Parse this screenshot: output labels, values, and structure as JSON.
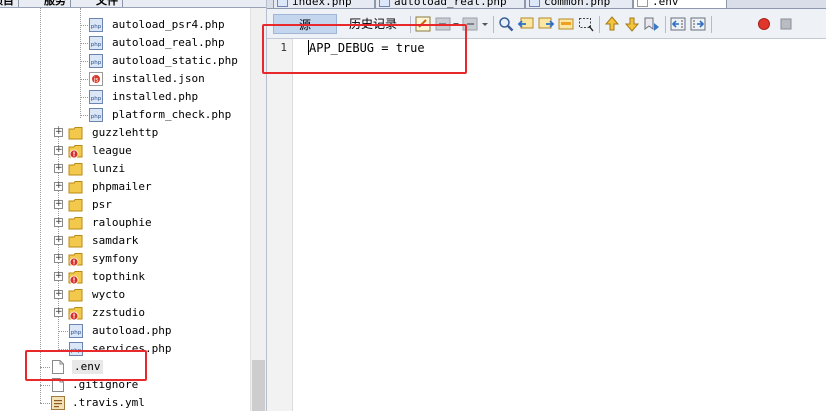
{
  "project_panel": {
    "tabs": [
      "项目",
      "服务",
      "文件"
    ],
    "tree": [
      {
        "label": "autoload_psr4.php",
        "icon": "php-file-icon"
      },
      {
        "label": "autoload_real.php",
        "icon": "php-file-icon"
      },
      {
        "label": "autoload_static.php",
        "icon": "php-file-icon"
      },
      {
        "label": "installed.json",
        "icon": "json-file-icon"
      },
      {
        "label": "installed.php",
        "icon": "php-file-icon"
      },
      {
        "label": "platform_check.php",
        "icon": "php-file-icon"
      },
      {
        "label": "guzzlehttp",
        "icon": "folder-icon"
      },
      {
        "label": "league",
        "icon": "folder-error-icon"
      },
      {
        "label": "lunzi",
        "icon": "folder-icon"
      },
      {
        "label": "phpmailer",
        "icon": "folder-icon"
      },
      {
        "label": "psr",
        "icon": "folder-icon"
      },
      {
        "label": "ralouphie",
        "icon": "folder-icon"
      },
      {
        "label": "samdark",
        "icon": "folder-icon"
      },
      {
        "label": "symfony",
        "icon": "folder-error-icon"
      },
      {
        "label": "topthink",
        "icon": "folder-error-icon"
      },
      {
        "label": "wycto",
        "icon": "folder-icon"
      },
      {
        "label": "zzstudio",
        "icon": "folder-error-icon"
      },
      {
        "label": "autoload.php",
        "icon": "php-file-icon"
      },
      {
        "label": "services.php",
        "icon": "php-file-icon"
      },
      {
        "label": ".env",
        "icon": "file-icon"
      },
      {
        "label": ".gitignore",
        "icon": "file-icon"
      },
      {
        "label": ".travis.yml",
        "icon": "yml-file-icon"
      }
    ]
  },
  "editor": {
    "tabs": [
      "index.php",
      "autoload_real.php",
      "common.php",
      ".env"
    ],
    "active_tab": ".env",
    "view_tabs": {
      "source": "源",
      "history": "历史记录"
    },
    "line_numbers": [
      "1"
    ],
    "lines": [
      "APP_DEBUG = true"
    ]
  },
  "colors": {
    "highlight_box": "#e8282a",
    "active_view_tab": "#c4d6ee"
  }
}
